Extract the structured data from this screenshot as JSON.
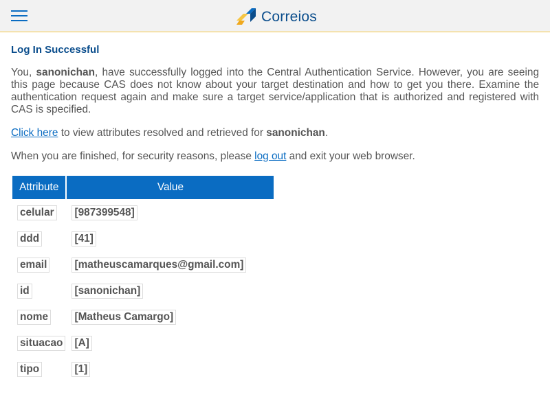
{
  "header": {
    "menu_icon": "hamburger-menu-icon",
    "logo_text": "Correios",
    "colors": {
      "brand_blue": "#0a4d8c",
      "brand_yellow": "#f6c644",
      "link": "#0a6cc2"
    }
  },
  "main": {
    "heading": "Log In Successful",
    "intro_prefix": "You, ",
    "username": "sanonichan",
    "intro_rest": ", have successfully logged into the Central Authentication Service. However, you are seeing this page because CAS does not know about your target destination and how to get you there. Examine the authentication request again and make sure a target service/application that is authorized and registered with CAS is specified.",
    "attr_link": "Click here",
    "attr_text": " to view attributes resolved and retrieved for ",
    "attr_user": "sanonichan",
    "attr_end": ".",
    "logout_prefix": "When you are finished, for security reasons, please ",
    "logout_link": "log out",
    "logout_suffix": " and exit your web browser."
  },
  "table": {
    "headers": [
      "Attribute",
      "Value"
    ],
    "rows": [
      {
        "attr": "celular",
        "value": "[987399548]"
      },
      {
        "attr": "ddd",
        "value": "[41]"
      },
      {
        "attr": "email",
        "value": "[matheuscamarques@gmail.com]"
      },
      {
        "attr": "id",
        "value": "[sanonichan]"
      },
      {
        "attr": "nome",
        "value": "[Matheus Camargo]"
      },
      {
        "attr": "situacao",
        "value": "[A]"
      },
      {
        "attr": "tipo",
        "value": "[1]"
      }
    ]
  }
}
